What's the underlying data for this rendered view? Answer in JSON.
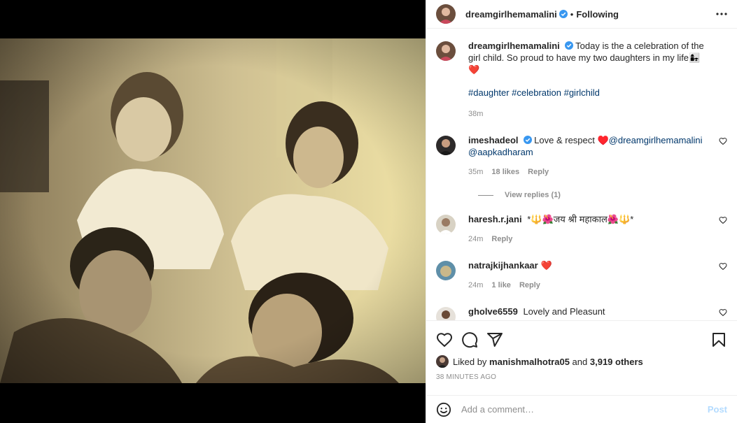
{
  "post": {
    "author": "dreamgirlhemamalini",
    "follow_dot": "•",
    "follow_status": "Following"
  },
  "caption": {
    "author": "dreamgirlhemamalini",
    "text": "Today is the a celebration of the girl child. So proud to have my two daughters in my life👩‍👧❤️",
    "hashtags": "#daughter #celebration #girlchild",
    "time": "38m"
  },
  "comments": [
    {
      "user": "imeshadeol",
      "verified": true,
      "text_before": "Love & respect ♥️",
      "mention1": "@dreamgirlhemamalini",
      "mention2": "@aapkadharam",
      "time": "35m",
      "likes": "18 likes",
      "reply": "Reply",
      "view_replies": "View replies (1)"
    },
    {
      "user": "haresh.r.jani",
      "text": "*🔱🌺जय श्री महाकाल🌺🔱*",
      "time": "24m",
      "reply": "Reply"
    },
    {
      "user": "natrajkijhankaar",
      "text": "❤️",
      "time": "24m",
      "likes": "1 like",
      "reply": "Reply"
    },
    {
      "user": "gholve6559",
      "text": "Lovely and Pleasunt"
    }
  ],
  "likes": {
    "prefix": "Liked by",
    "user": "manishmalhotra05",
    "middle": "and",
    "others": "3,919 others"
  },
  "timestamp": "38 MINUTES AGO",
  "add_comment": {
    "placeholder": "Add a comment…",
    "post_label": "Post"
  },
  "icons": {
    "like": "heart-icon",
    "comment": "comment-icon",
    "share": "share-icon",
    "save": "bookmark-icon",
    "more": "more-icon",
    "emoji": "emoji-icon",
    "verified": "verified-icon"
  },
  "colors": {
    "verified_blue": "#3897f0",
    "link": "#00376b",
    "muted": "#8e8e8e",
    "post_disabled": "#b3dbff"
  }
}
